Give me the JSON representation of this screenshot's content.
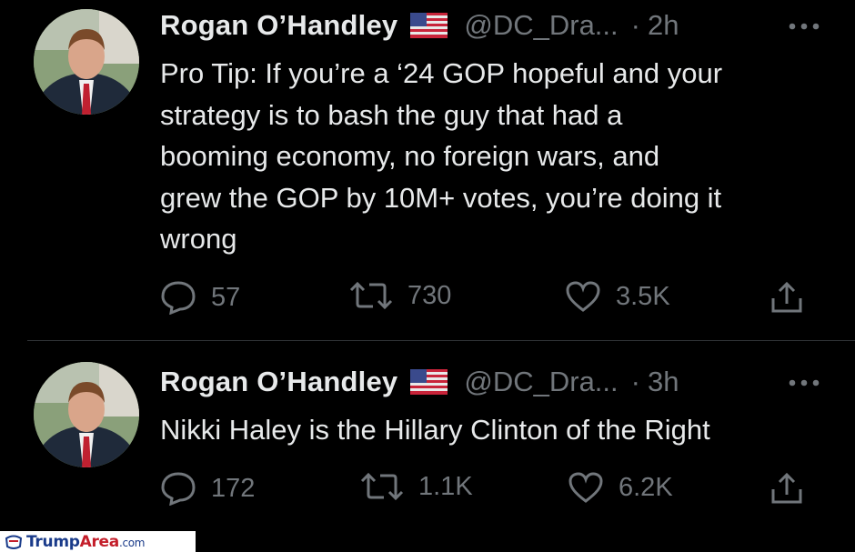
{
  "tweets": [
    {
      "name": "Rogan O’Handley",
      "handle": "@DC_Dra...",
      "separator": "·",
      "time": "2h",
      "text": "Pro Tip: If you’re a ‘24 GOP hopeful and your\nstrategy is to bash the guy that had a\nbooming economy, no foreign wars, and\ngrew the GOP by 10M+ votes, you’re doing it\nwrong",
      "replies": "57",
      "retweets": "730",
      "likes": "3.5K"
    },
    {
      "name": "Rogan O’Handley",
      "handle": "@DC_Dra...",
      "separator": "·",
      "time": "3h",
      "text": "Nikki Haley is the Hillary Clinton of the Right",
      "replies": "172",
      "retweets": "1.1K",
      "likes": "6.2K"
    }
  ],
  "watermark": {
    "brand_primary": "Trump",
    "brand_secondary": "Area",
    "suffix": ".com"
  },
  "icons": {
    "reply": "reply-icon",
    "retweet": "retweet-icon",
    "like": "heart-icon",
    "share": "share-icon",
    "more": "more-icon",
    "flag": "us-flag-icon"
  },
  "colors": {
    "background": "#000000",
    "text": "#e7e9ea",
    "muted": "#71767b"
  }
}
